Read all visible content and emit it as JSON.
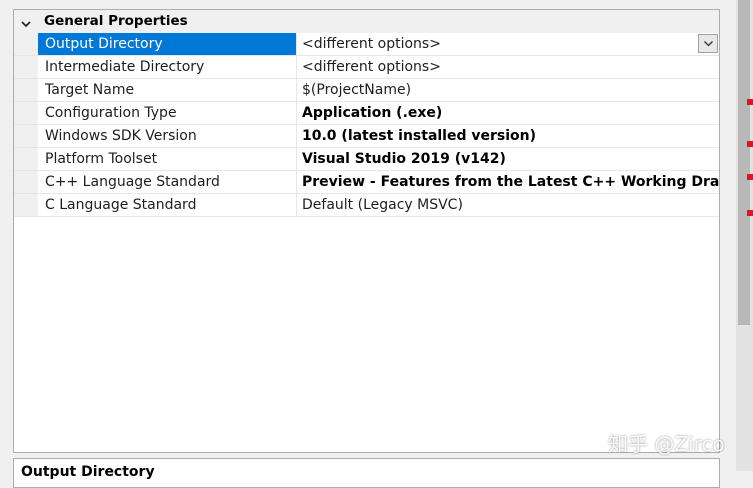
{
  "category": {
    "label": "General Properties"
  },
  "properties": [
    {
      "name": "Output Directory",
      "value": "<different options>",
      "bold": false,
      "selected": true
    },
    {
      "name": "Intermediate Directory",
      "value": "<different options>",
      "bold": false,
      "selected": false
    },
    {
      "name": "Target Name",
      "value": "$(ProjectName)",
      "bold": false,
      "selected": false
    },
    {
      "name": "Configuration Type",
      "value": "Application (.exe)",
      "bold": true,
      "selected": false
    },
    {
      "name": "Windows SDK Version",
      "value": "10.0 (latest installed version)",
      "bold": true,
      "selected": false
    },
    {
      "name": "Platform Toolset",
      "value": "Visual Studio 2019 (v142)",
      "bold": true,
      "selected": false
    },
    {
      "name": "C++ Language Standard",
      "value": "Preview - Features from the Latest C++ Working Draft (/std",
      "bold": true,
      "selected": false
    },
    {
      "name": "C Language Standard",
      "value": "Default (Legacy MSVC)",
      "bold": false,
      "selected": false
    }
  ],
  "description": {
    "title": "Output Directory"
  },
  "watermark": "知乎 @Zirco",
  "icons": {
    "expander": "chevron-down-icon",
    "dropdown": "dropdown-arrow-icon"
  },
  "colors": {
    "selection": "#0078d7",
    "panel_border": "#adadad",
    "gutter": "#f0f0f0"
  }
}
